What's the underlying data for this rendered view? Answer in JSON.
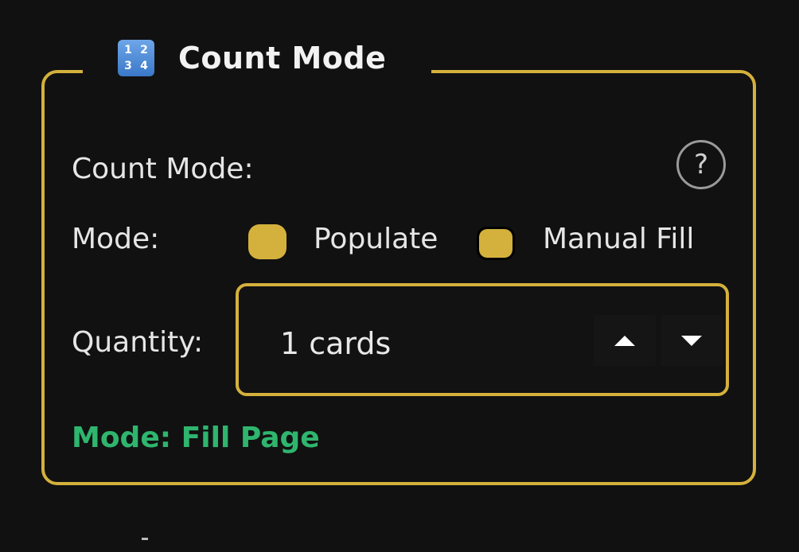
{
  "group": {
    "title": "Count Mode",
    "icon": "input-numbers-icon",
    "icon_glyphs": [
      "1",
      "2",
      "3",
      "4"
    ],
    "accent_color": "#d4b13c"
  },
  "count_mode": {
    "label": "Count Mode:",
    "help_glyph": "?"
  },
  "mode": {
    "label": "Mode:",
    "options": [
      {
        "label": "Populate",
        "selected": true
      },
      {
        "label": "Manual Fill",
        "selected": false
      }
    ]
  },
  "quantity": {
    "label": "Quantity:",
    "value": "1 cards"
  },
  "status": {
    "text": "Mode: Fill Page",
    "color": "#2fb56e"
  }
}
